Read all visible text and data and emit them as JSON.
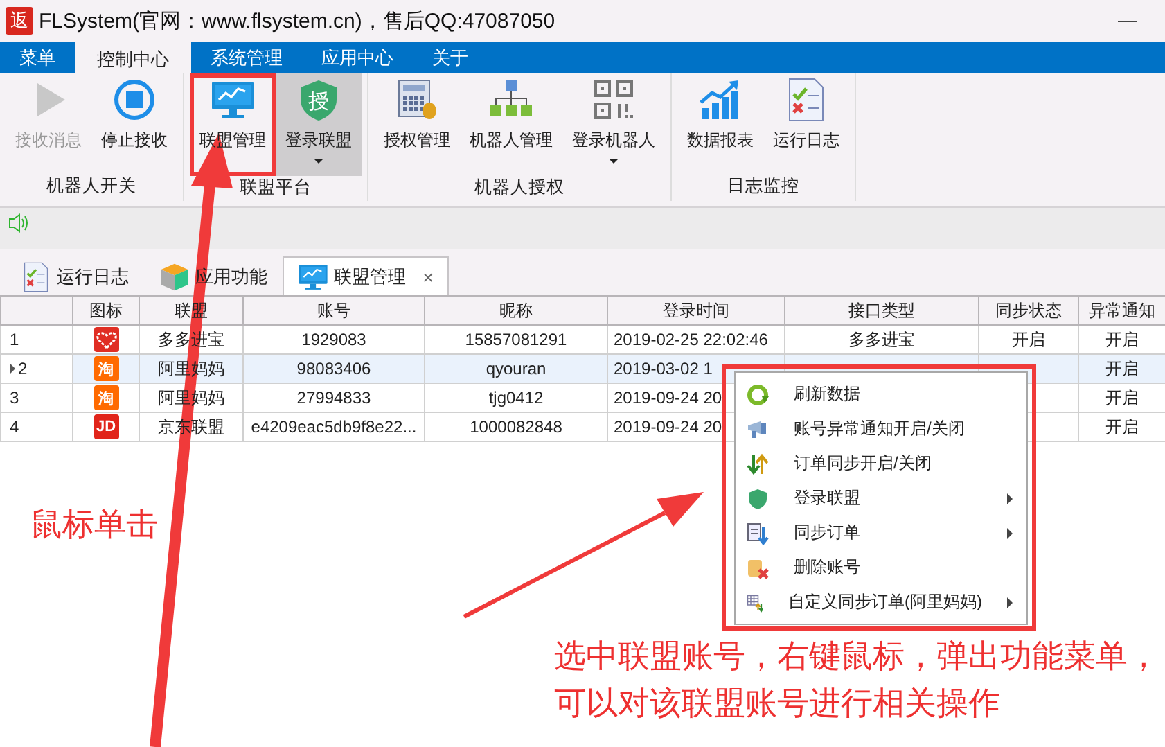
{
  "window": {
    "title": "FLSystem(官网：www.flsystem.cn)，售后QQ:47087050",
    "icon_text": "返"
  },
  "menu_tabs": [
    {
      "label": "菜单",
      "selected": false
    },
    {
      "label": "控制中心",
      "selected": true
    },
    {
      "label": "系统管理",
      "selected": false
    },
    {
      "label": "应用中心",
      "selected": false
    },
    {
      "label": "关于",
      "selected": false
    }
  ],
  "ribbon_groups": [
    {
      "label": "机器人开关",
      "buttons": [
        {
          "label": "接收消息",
          "kind": "play",
          "disabled": true,
          "dropdown": false,
          "highlighted": false
        },
        {
          "label": "停止接收",
          "kind": "stop",
          "disabled": false,
          "dropdown": false,
          "highlighted": false
        }
      ]
    },
    {
      "label": "联盟平台",
      "buttons": [
        {
          "label": "联盟管理",
          "kind": "monitor",
          "disabled": false,
          "dropdown": false,
          "highlighted": false,
          "annotated": true
        },
        {
          "label": "登录联盟",
          "kind": "shield",
          "shield_text": "授",
          "disabled": false,
          "dropdown": true,
          "highlighted": true
        }
      ]
    },
    {
      "label": "机器人授权",
      "buttons": [
        {
          "label": "授权管理",
          "kind": "calculator",
          "disabled": false,
          "dropdown": false,
          "highlighted": false
        },
        {
          "label": "机器人管理",
          "kind": "network",
          "disabled": false,
          "dropdown": false,
          "highlighted": false
        },
        {
          "label": "登录机器人",
          "kind": "qrcode",
          "disabled": false,
          "dropdown": true,
          "highlighted": false
        }
      ]
    },
    {
      "label": "日志监控",
      "buttons": [
        {
          "label": "数据报表",
          "kind": "chart",
          "disabled": false,
          "dropdown": false,
          "highlighted": false
        },
        {
          "label": "运行日志",
          "kind": "checklist",
          "disabled": false,
          "dropdown": false,
          "highlighted": false
        }
      ]
    }
  ],
  "doc_tabs": [
    {
      "label": "运行日志",
      "kind": "checklist",
      "selected": false,
      "closable": false
    },
    {
      "label": "应用功能",
      "kind": "cube",
      "selected": false,
      "closable": false
    },
    {
      "label": "联盟管理",
      "kind": "monitor",
      "selected": true,
      "closable": true,
      "close_text": "×"
    }
  ],
  "table": {
    "columns": [
      "",
      "图标",
      "联盟",
      "账号",
      "昵称",
      "登录时间",
      "接口类型",
      "同步状态",
      "异常通知"
    ],
    "rows": [
      {
        "selected": false,
        "cells": [
          "1",
          {
            "kind": "pdd"
          },
          "多多进宝",
          "1929083",
          "15857081291",
          "2019-02-25 22:02:46",
          "多多进宝",
          "开启",
          "开启"
        ]
      },
      {
        "selected": true,
        "cells": [
          "2",
          {
            "kind": "taobao",
            "text": "淘"
          },
          "阿里妈妈",
          "98083406",
          "qyouran",
          "2019-03-02 1",
          null,
          null,
          "开启"
        ]
      },
      {
        "selected": false,
        "cells": [
          "3",
          {
            "kind": "taobao",
            "text": "淘"
          },
          "阿里妈妈",
          "27994833",
          "tjg0412",
          "2019-09-24 20",
          null,
          null,
          "开启"
        ]
      },
      {
        "selected": false,
        "cells": [
          "4",
          {
            "kind": "jd",
            "text": "JD"
          },
          "京东联盟",
          "e4209eac5db9f8e22...",
          "1000082848",
          "2019-09-24 20",
          null,
          null,
          "开启"
        ]
      }
    ]
  },
  "context_menu": [
    {
      "label": "刷新数据",
      "kind": "refresh",
      "submenu": false
    },
    {
      "label": "账号异常通知开启/关闭",
      "kind": "horn",
      "submenu": false
    },
    {
      "label": "订单同步开启/关闭",
      "kind": "arrows",
      "submenu": false
    },
    {
      "label": "登录联盟",
      "kind": "shield",
      "submenu": true
    },
    {
      "label": "同步订单",
      "kind": "sync",
      "submenu": true
    },
    {
      "label": "删除账号",
      "kind": "delete",
      "submenu": false
    },
    {
      "label": "自定义同步订单(阿里妈妈)",
      "kind": "grid",
      "submenu": true
    }
  ],
  "annotations": {
    "click_note": "鼠标单击",
    "menu_note": [
      "选中联盟账号，右键鼠标，弹出功能菜单，",
      "可以对该联盟账号进行相关操作"
    ]
  }
}
